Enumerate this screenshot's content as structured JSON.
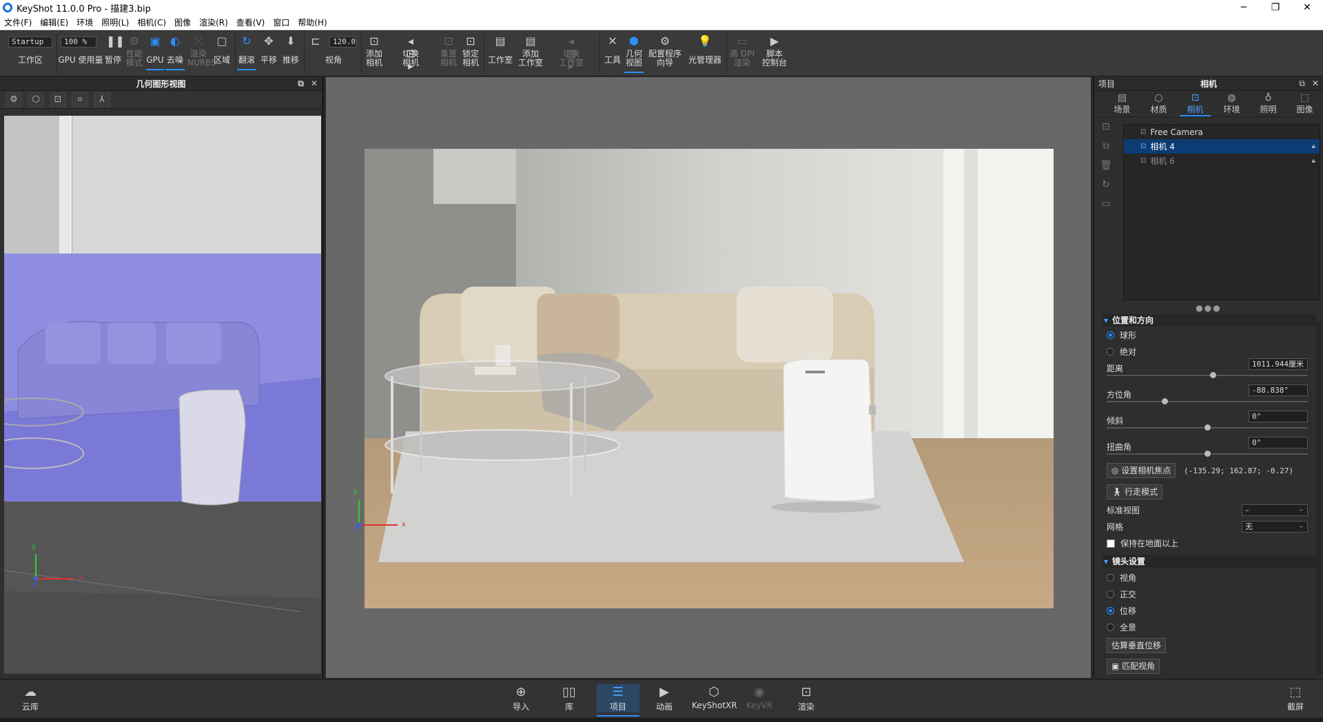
{
  "window": {
    "title": "KeyShot 11.0.0 Pro  - 描建3.bip",
    "min": "─",
    "max": "❐",
    "close": "✕"
  },
  "menu": [
    "文件(F)",
    "编辑(E)",
    "环境",
    "照明(L)",
    "相机(C)",
    "图像",
    "渲染(R)",
    "查看(V)",
    "窗口",
    "帮助(H)"
  ],
  "toolbar": {
    "workspace_value": "Startup",
    "workspace_label": "工作区",
    "gpu_usage_value": "100 %",
    "gpu_usage_label": "GPU 使用量",
    "pause": "暂停",
    "perf_mode": "性能\n模式",
    "gpu": "GPU",
    "denoise": "去噪",
    "render_nurbs": "渲染\nNURBS",
    "region": "区域",
    "tumble": "翻滚",
    "pan": "平移",
    "dolly": "推移",
    "fov_value": "120.0",
    "fov_label": "视角",
    "add_camera": "添加\n相机",
    "switch_camera": "切换\n相机",
    "reset_camera": "重置\n相机",
    "lock_camera": "锁定\n相机",
    "studio": "工作室",
    "add_studio": "添加\n工作室",
    "switch_studio": "切换\n工作室",
    "tools": "工具",
    "geometry_view": "几何\n视图",
    "config_wizard": "配置程序\n向导",
    "light_manager": "光管理器",
    "hdpi_render": "高 DPI\n渲染",
    "script_console": "脚本\n控制台"
  },
  "geometry_panel": {
    "title": "几何图形视图"
  },
  "axes": {
    "x": "x",
    "y": "y",
    "z": "z"
  },
  "right_panel": {
    "title_left": "项目",
    "title_center": "相机",
    "tabs": [
      "场景",
      "材质",
      "相机",
      "环境",
      "照明",
      "图像"
    ],
    "cameras": [
      {
        "name": "Free Camera"
      },
      {
        "name": "相机 4"
      },
      {
        "name": "相机 6"
      }
    ],
    "position_section": "位置和方向",
    "mode_sphere": "球形",
    "mode_absolute": "绝对",
    "distance_label": "距离",
    "distance_value": "1011.944厘米",
    "azimuth_label": "方位角",
    "azimuth_value": "-88.838°",
    "inclination_label": "倾斜",
    "inclination_value": "0°",
    "twist_label": "扭曲角",
    "twist_value": "0°",
    "set_focus_btn": "设置相机焦点",
    "focus_coords": "(-135.29; 162.87; -0.27)",
    "walk_mode_btn": "行走模式",
    "std_view_label": "标准视图",
    "std_view_value": "–",
    "grid_label": "网格",
    "grid_value": "无",
    "keep_above_ground": "保持在地面以上",
    "lens_section": "镜头设置",
    "lens_fov": "视角",
    "lens_ortho": "正交",
    "lens_shift": "位移",
    "lens_pano": "全景",
    "estimate_shift_btn": "估算垂直位移",
    "match_fov_btn": "匹配视角"
  },
  "bottom": {
    "cloud": "云库",
    "import": "导入",
    "library": "库",
    "project": "项目",
    "animation": "动画",
    "keyshotxr": "KeyShotXR",
    "keyvr": "KeyVR",
    "render": "渲染",
    "screenshot": "截屏"
  },
  "colors": {
    "accent": "#2a8fff",
    "selection": "#0d3b73"
  }
}
